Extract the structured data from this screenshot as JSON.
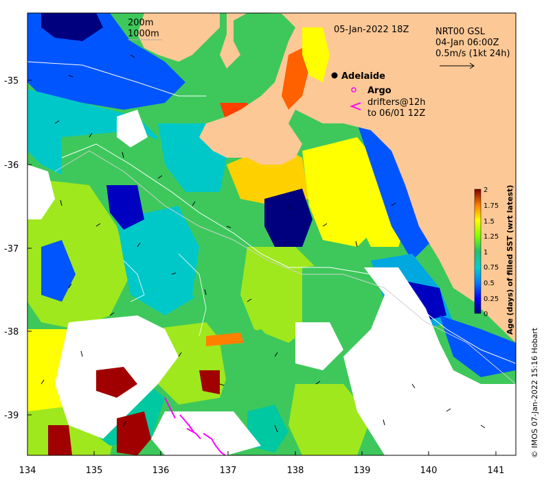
{
  "map": {
    "longitude_ticks": [
      "134",
      "135",
      "136",
      "137",
      "138",
      "139",
      "140",
      "141"
    ],
    "latitude_ticks": [
      "-35",
      "-36",
      "-37",
      "-38",
      "-39"
    ],
    "lon_range": [
      134,
      141.3
    ],
    "lat_range": [
      -39.5,
      -34.2
    ]
  },
  "annotations": {
    "depth_200": "200m",
    "depth_1000": "1000m",
    "date": "05-Jan-2022 18Z",
    "current_source": "NRT00 GSL",
    "current_time": "04-Jan 06:00Z",
    "vector_scale": "0.5m/s (1kt 24h)",
    "adelaide": "Adelaide",
    "argo": "Argo",
    "drifters_line1": "drifters@12h",
    "drifters_line2": "to 06/01 12Z"
  },
  "colorbar": {
    "title": "Age (days) of filled SST (wrt latest)",
    "ticks": [
      "2",
      "1.75",
      "1.5",
      "1.25",
      "1",
      "0.75",
      "0.5",
      "0.25",
      "0"
    ],
    "range": [
      0,
      2
    ]
  },
  "credit": "© IMOS 07-Jan-2022 15:16 Hobart",
  "colors": {
    "land": "#fcc896",
    "no_data": "#ffffff",
    "argo_drifter": "#ff00ff",
    "age_scale": [
      "#00007f",
      "#0000ff",
      "#007fff",
      "#00cfcf",
      "#20c070",
      "#7fff00",
      "#ffff00",
      "#ffb000",
      "#ff4000",
      "#7f0000"
    ]
  }
}
